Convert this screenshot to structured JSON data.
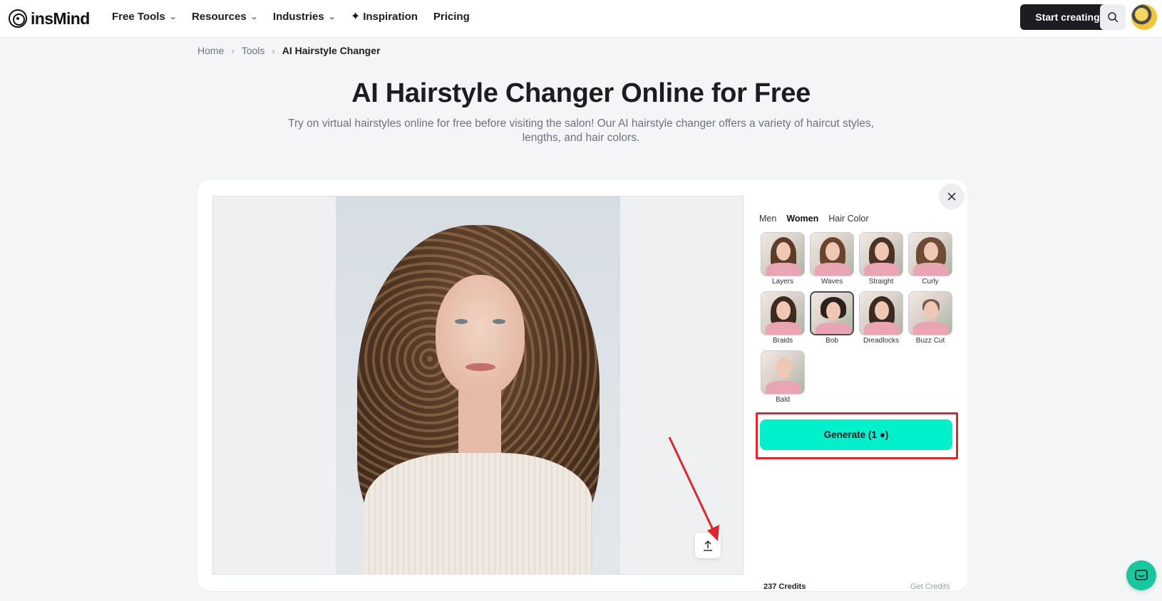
{
  "brand": {
    "name": "insMind"
  },
  "nav": {
    "items": [
      {
        "label": "Free Tools",
        "has_dropdown": true
      },
      {
        "label": "Resources",
        "has_dropdown": true
      },
      {
        "label": "Industries",
        "has_dropdown": true
      },
      {
        "label": "Inspiration",
        "has_dropdown": false,
        "icon": "sparkle-icon"
      },
      {
        "label": "Pricing",
        "has_dropdown": false
      }
    ],
    "start_label": "Start creating"
  },
  "breadcrumb": {
    "items": [
      "Home",
      "Tools",
      "AI Hairstyle Changer"
    ]
  },
  "hero": {
    "title": "AI Hairstyle Changer Online for Free",
    "subtitle": "Try on virtual hairstyles online for free before visiting the salon! Our AI hairstyle changer offers a variety of haircut styles, lengths, and hair colors."
  },
  "panel": {
    "tabs": [
      "Men",
      "Women",
      "Hair Color"
    ],
    "active_tab": "Women",
    "styles": [
      "Layers",
      "Waves",
      "Straight",
      "Curly",
      "Braids",
      "Bob",
      "Dreadlocks",
      "Buzz Cut",
      "Bald"
    ],
    "selected_style": "Bob",
    "credits_label": "237 Credits",
    "get_credits_label": "Get Credits",
    "generate_label": "Generate (1 ●)"
  },
  "colors": {
    "generate_bg": "#00f0cc",
    "annotation": "#e0262c",
    "chat": "#18c7a0"
  }
}
